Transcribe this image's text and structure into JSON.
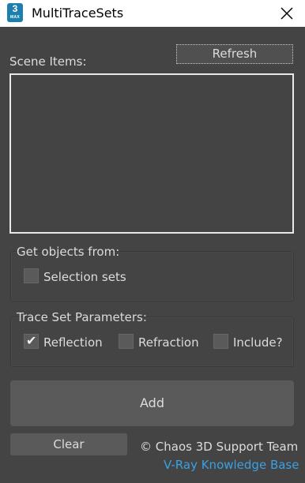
{
  "window": {
    "title": "MultiTraceSets",
    "app_icon_number": "3",
    "app_icon_text": "MAX"
  },
  "scene": {
    "label": "Scene Items:",
    "refresh_label": "Refresh",
    "items": []
  },
  "get_objects": {
    "group_label": "Get objects from:",
    "selection_sets_label": "Selection sets",
    "selection_sets_checked": false
  },
  "trace_params": {
    "group_label": "Trace Set Parameters:",
    "reflection_label": "Reflection",
    "reflection_checked": true,
    "refraction_label": "Refraction",
    "refraction_checked": false,
    "include_label": "Include?",
    "include_checked": false
  },
  "actions": {
    "add_label": "Add",
    "clear_label": "Clear"
  },
  "footer": {
    "credit": "© Chaos 3D Support Team",
    "kb_link": "V-Ray Knowledge Base"
  },
  "colors": {
    "background": "#444444",
    "link": "#3aa0e6",
    "app_icon": "#1d7fae"
  }
}
